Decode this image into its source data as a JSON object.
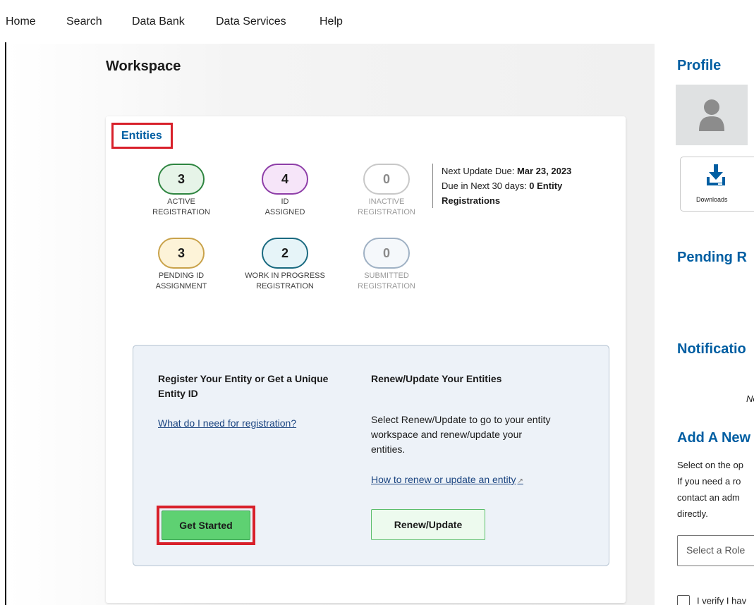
{
  "nav": {
    "items": [
      "Home",
      "Search",
      "Data Bank",
      "Data Services",
      "Help"
    ]
  },
  "workspace": {
    "title": "Workspace",
    "entities": {
      "title": "Entities",
      "stats": [
        {
          "count": "3",
          "label_line1": "ACTIVE",
          "label_line2": "REGISTRATION",
          "color": "#2e8540",
          "fill": "#e6f4e8"
        },
        {
          "count": "4",
          "label_line1": "ID",
          "label_line2": "ASSIGNED",
          "color": "#8e3ea8",
          "fill": "#f6e5f9"
        },
        {
          "count": "0",
          "label_line1": "INACTIVE",
          "label_line2": "REGISTRATION",
          "color": "#b0b0b0",
          "fill": "#ffffff"
        },
        {
          "count": "3",
          "label_line1": "PENDING ID",
          "label_line2": "ASSIGNMENT",
          "color": "#c9a24a",
          "fill": "#fdf3d8"
        },
        {
          "count": "2",
          "label_line1": "WORK IN PROGRESS",
          "label_line2": "REGISTRATION",
          "color": "#1a6a80",
          "fill": "#e6f4f8"
        },
        {
          "count": "0",
          "label_line1": "SUBMITTED",
          "label_line2": "REGISTRATION",
          "color": "#9fb1c4",
          "fill": "#f5f8fb"
        }
      ],
      "next_update_prefix": "Next Update Due: ",
      "next_update_date": "Mar 23, 2023",
      "due_prefix": "Due in Next 30 days: ",
      "due_value": "0 Entity",
      "due_value_2": "Registrations"
    },
    "register": {
      "title_line1": "Register Your Entity or Get a Unique",
      "title_line2": "Entity ID",
      "link": "What do I need for registration?",
      "button": "Get Started"
    },
    "renew": {
      "title": "Renew/Update Your Entities",
      "text_line1": "Select Renew/Update to go to your entity",
      "text_line2": "workspace and renew/update your",
      "text_line3": "entities.",
      "link": "How to renew or update an entity",
      "button": "Renew/Update"
    }
  },
  "right": {
    "profile_title": "Profile",
    "downloads_label": "Downloads",
    "pending_title": "Pending R",
    "notifications_title": "Notificatio",
    "notifications_note": "No",
    "add_new_title": "Add A New",
    "add_new_text": [
      "Select on the op",
      "If you need a ro",
      "contact an adm",
      "directly."
    ],
    "role_placeholder": "Select a Role",
    "verify_text": "I verify I hav"
  },
  "colors": {
    "accent_blue": "#005ea2",
    "highlight_red": "#d8202a",
    "get_started_green": "#5ed172"
  }
}
